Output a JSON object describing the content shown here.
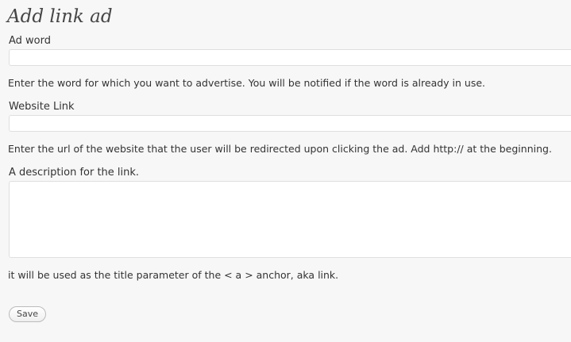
{
  "page": {
    "title": "Add link ad"
  },
  "form": {
    "ad_word": {
      "label": "Ad word",
      "value": "",
      "help": "Enter the word for which you want to advertise. You will be notified if the word is already in use."
    },
    "website_link": {
      "label": "Website Link",
      "value": "",
      "help": "Enter the url of the website that the user will be redirected upon clicking the ad. Add http:// at the beginning."
    },
    "description": {
      "label": "A description for the link.",
      "value": "",
      "help": "it will be used as the title parameter of the < a > anchor, aka link."
    },
    "save_label": "Save"
  }
}
